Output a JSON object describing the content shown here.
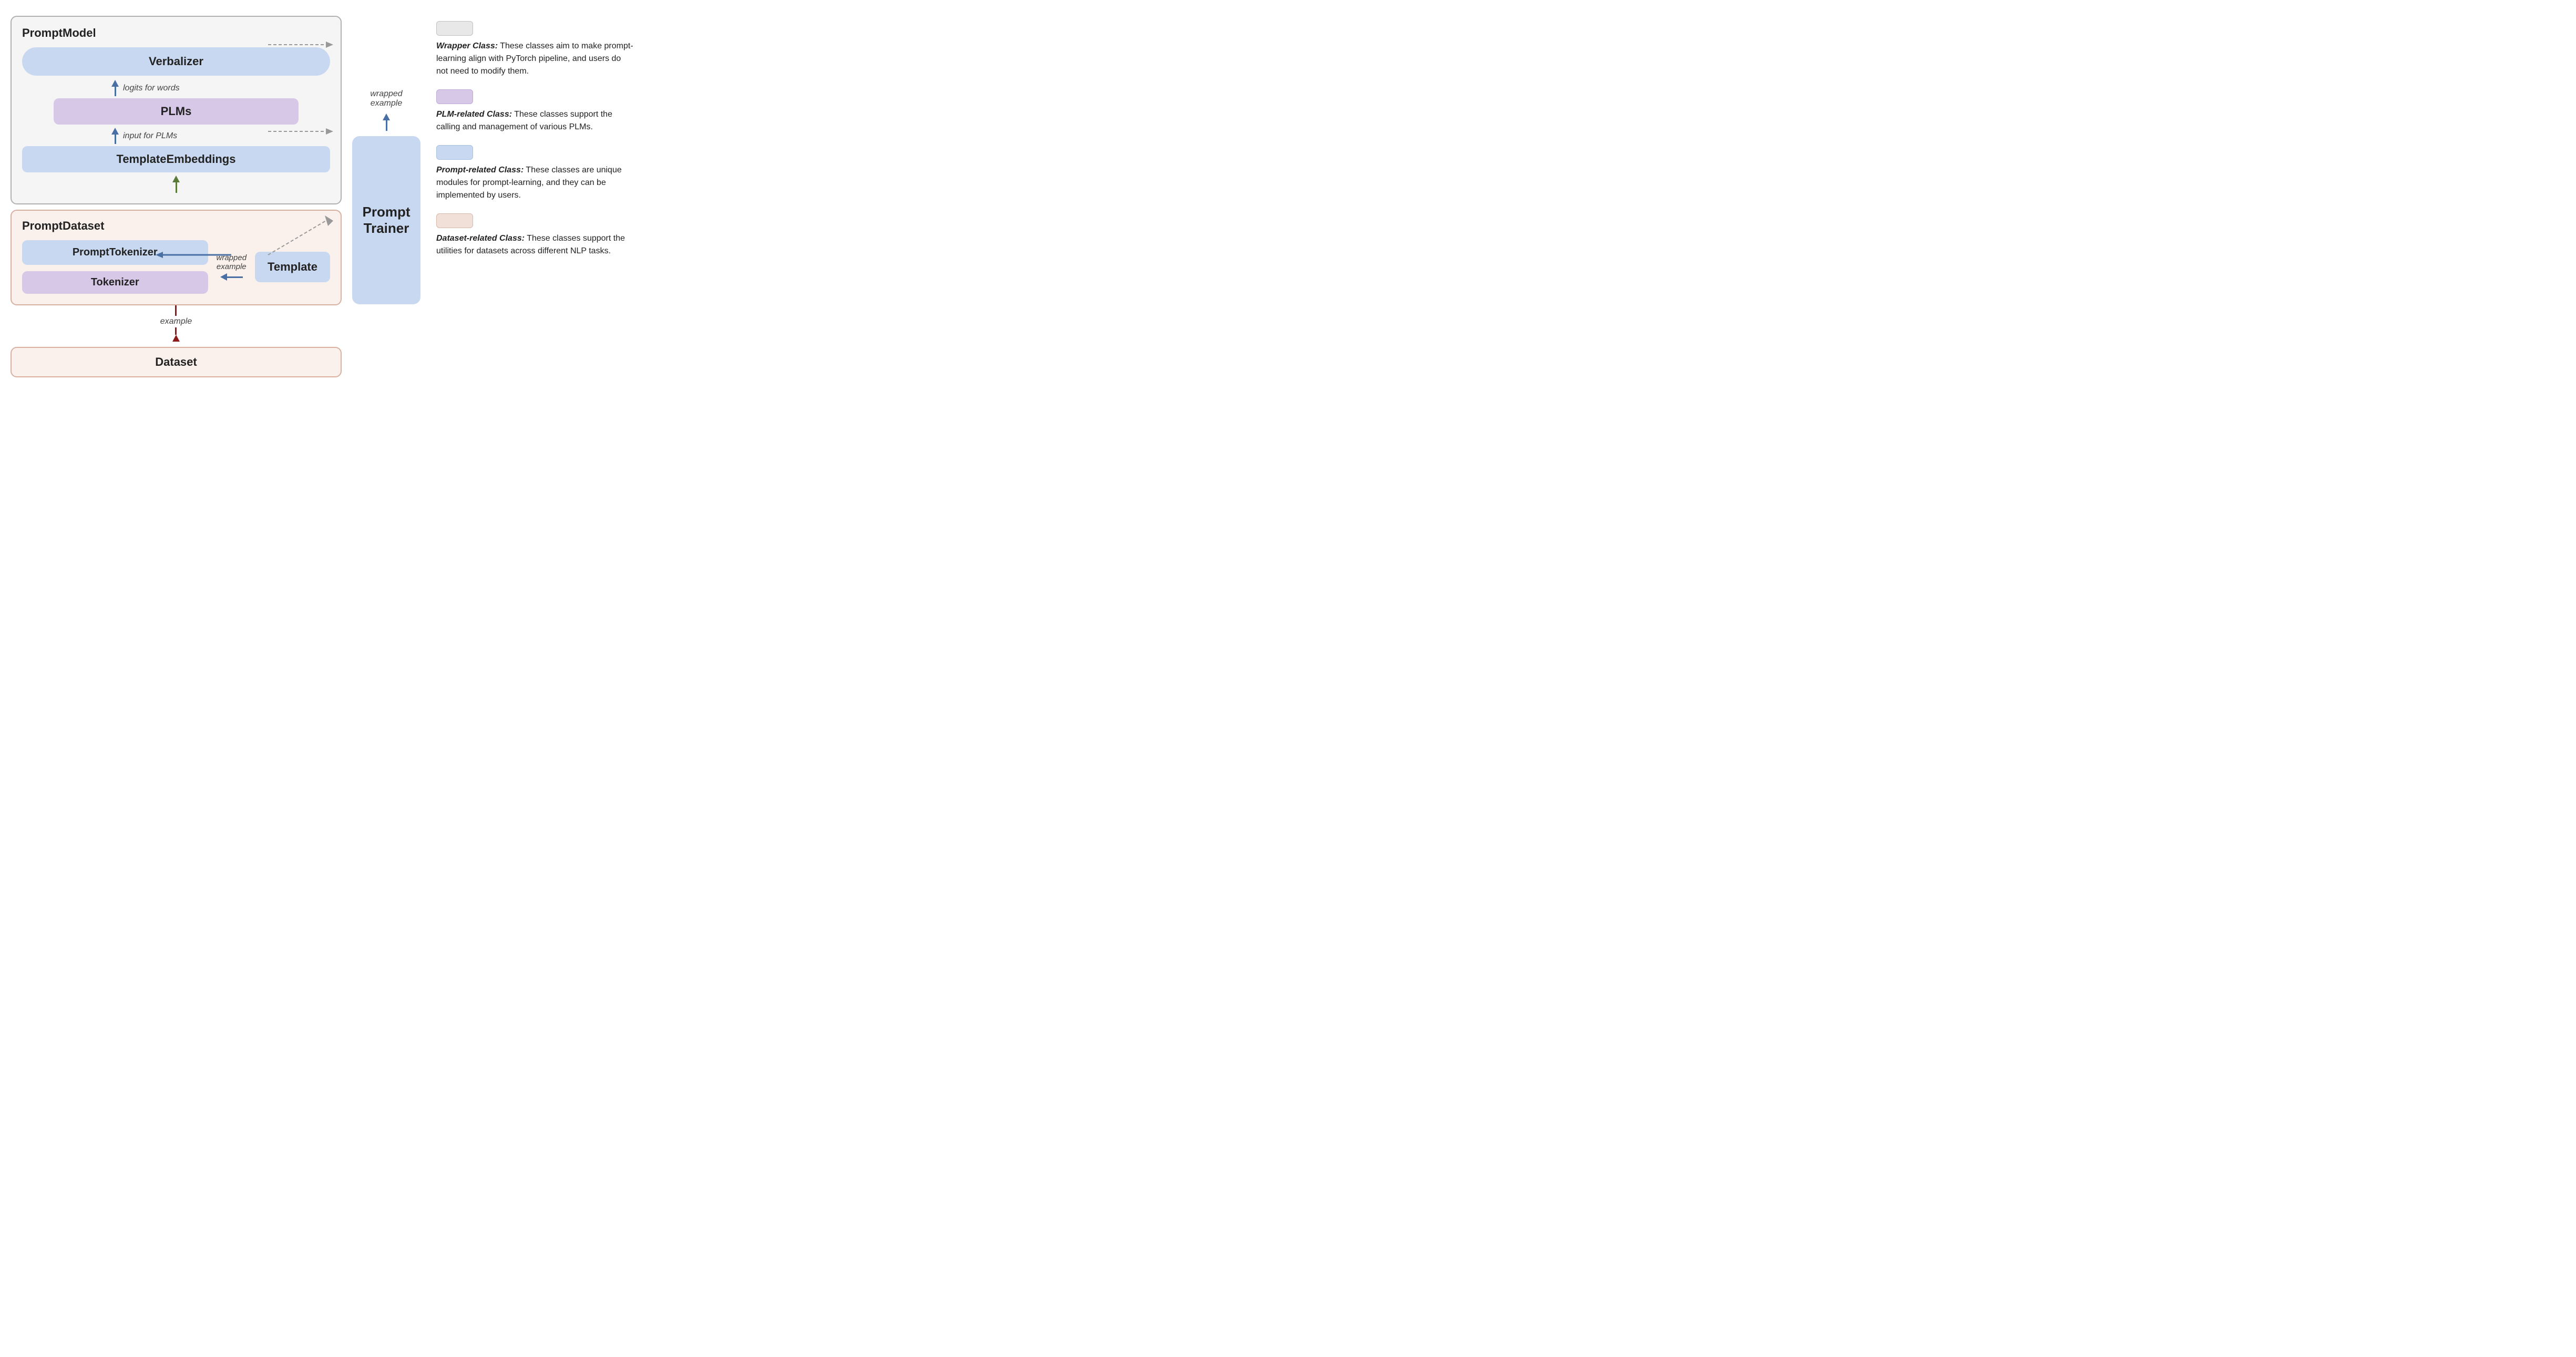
{
  "diagram": {
    "promptModel": {
      "label": "PromptModel",
      "verbalizer": "Verbalizer",
      "logitsLabel": "logits for words",
      "plms": "PLMs",
      "inputLabel": "input for PLMs",
      "templateEmbeddings": "TemplateEmbeddings",
      "wrappedExample": "wrapped example"
    },
    "promptDataset": {
      "label": "PromptDataset",
      "promptTokenizer": "PromptTokenizer",
      "tokenizer": "Tokenizer",
      "template": "Template",
      "wrappedExampleLabel": "wrapped example",
      "exampleLabel": "example"
    },
    "dataset": {
      "label": "Dataset"
    },
    "promptTrainer": {
      "label": "Prompt Trainer"
    }
  },
  "legend": {
    "items": [
      {
        "color": "#e8e8e8",
        "border": "#c0c0c0",
        "boldLabel": "Wrapper Class:",
        "text": " These classes aim to make prompt-learning align with PyTorch pipeline, and users do not need to modify them."
      },
      {
        "color": "#d8c8e8",
        "border": "#c0a8d8",
        "boldLabel": "PLM-related Class:",
        "text": " These classes support the calling and management of various PLMs."
      },
      {
        "color": "#c8d8f0",
        "border": "#a8c0e0",
        "boldLabel": "Prompt-related Class:",
        "text": " These classes are unique modules for prompt-learning, and they can be implemented by users."
      },
      {
        "color": "#f0e0d8",
        "border": "#d8b8a8",
        "boldLabel": "Dataset-related Class:",
        "text": " These classes support the utilities for datasets across different NLP tasks."
      }
    ]
  }
}
